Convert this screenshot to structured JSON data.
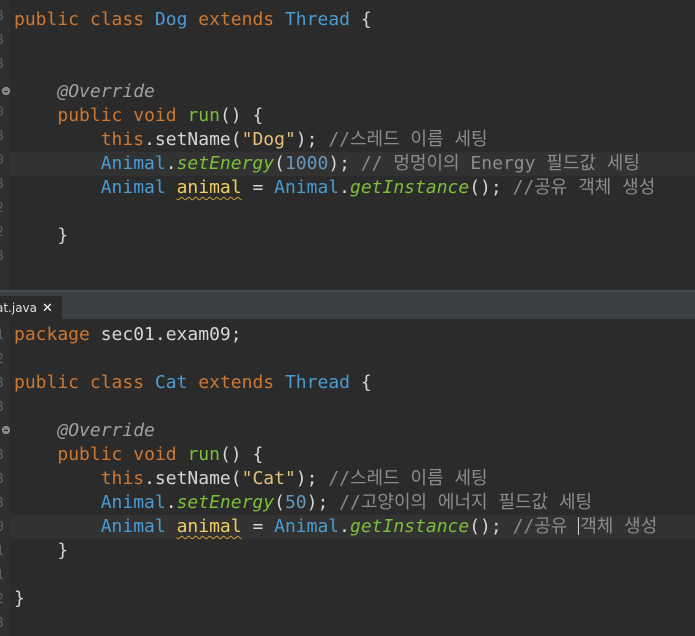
{
  "top_editor": {
    "lines": {
      "l1": {
        "kw1": "public",
        "kw2": "class",
        "cls": "Dog",
        "kw3": "extends",
        "parent": "Thread",
        "brace": "{"
      },
      "l4": {
        "ann": "@Override"
      },
      "l5": {
        "kw1": "public",
        "kw2": "void",
        "mth": "run",
        "rest": "() {"
      },
      "l6": {
        "kw": "this",
        "mth": ".setName(",
        "str": "\"Dog\"",
        "rest": "); ",
        "cmt": "//스레드 이름 세팅"
      },
      "l7": {
        "cls": "Animal",
        "dot": ".",
        "mth": "setEnergy",
        "open": "(",
        "num": "1000",
        "rest": "); ",
        "cmt": "// 멍멍이의 Energy 필드값 세팅"
      },
      "l8": {
        "cls": "Animal",
        "var": "animal",
        "eq": " = ",
        "cls2": "Animal",
        "dot": ".",
        "mth": "getInstance",
        "rest": "(); ",
        "cmt": "//공유 객체 생성"
      },
      "l10": {
        "brace": "}"
      }
    },
    "gutter": [
      "3",
      "3",
      "3",
      "0",
      "0",
      "3",
      "0",
      "3",
      "2",
      "2",
      "3"
    ]
  },
  "tab": {
    "label": "at.java",
    "close": "✕"
  },
  "bottom_editor": {
    "lines": {
      "l1": {
        "kw": "package",
        "pkg": " sec01.exam09;"
      },
      "l3": {
        "kw1": "public",
        "kw2": "class",
        "cls": "Cat",
        "kw3": "extends",
        "parent": "Thread",
        "brace": "{"
      },
      "l5": {
        "ann": "@Override"
      },
      "l6": {
        "kw1": "public",
        "kw2": "void",
        "mth": "run",
        "rest": "() {"
      },
      "l7": {
        "kw": "this",
        "mth": ".setName(",
        "str": "\"Cat\"",
        "rest": "); ",
        "cmt": "//스레드 이름 세팅"
      },
      "l8": {
        "cls": "Animal",
        "dot": ".",
        "mth": "setEnergy",
        "open": "(",
        "num": "50",
        "rest": "); ",
        "cmt": "//고양이의 에너지 필드값 세팅"
      },
      "l9": {
        "cls": "Animal",
        "var": "animal",
        "eq": " = ",
        "cls2": "Animal",
        "dot": ".",
        "mth": "getInstance",
        "rest": "(); ",
        "cmt1": "//공유 ",
        "cmt2": "객체 생성"
      },
      "l10": {
        "brace": "}"
      },
      "l12": {
        "brace": "}"
      }
    },
    "gutter": [
      "1",
      "2",
      "3",
      "3",
      "0",
      "3",
      "3",
      "3",
      "0",
      "1",
      "1",
      "2",
      "3"
    ]
  },
  "colors": {
    "background": "#2b2b2b",
    "keyword": "#cc7832",
    "class": "#4b9cd2",
    "method": "#7cbf3a",
    "string": "#e6c07b",
    "number": "#6897bb",
    "comment": "#8c8c8c",
    "variable": "#f0d060"
  },
  "icons": {
    "fold": "fold-minus-icon",
    "close": "close-icon"
  }
}
